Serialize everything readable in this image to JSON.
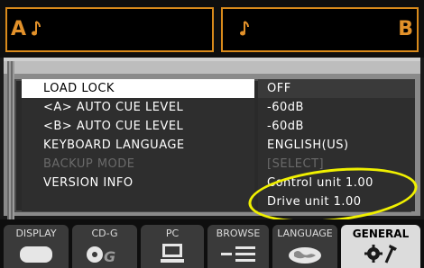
{
  "decks": {
    "a": {
      "letter": "A"
    },
    "b": {
      "letter": "B"
    }
  },
  "menu": {
    "rows": [
      {
        "label": "LOAD LOCK",
        "value": "OFF"
      },
      {
        "label": "<A> AUTO CUE LEVEL",
        "value": "-60dB"
      },
      {
        "label": "<B> AUTO CUE LEVEL",
        "value": "-60dB"
      },
      {
        "label": "KEYBOARD LANGUAGE",
        "value": "ENGLISH(US)"
      },
      {
        "label": "BACKUP MODE",
        "value": "[SELECT]"
      },
      {
        "label": "VERSION INFO",
        "value": "Control unit 1.00"
      },
      {
        "label": "",
        "value": "Drive unit 1.00"
      }
    ],
    "selected_index": 0,
    "disabled_index": 4
  },
  "tabs": [
    {
      "label": "DISPLAY",
      "icon": "display-icon"
    },
    {
      "label": "CD-G",
      "icon": "cd-g-icon"
    },
    {
      "label": "PC",
      "icon": "pc-icon"
    },
    {
      "label": "BROWSE",
      "icon": "browse-icon"
    },
    {
      "label": "LANGUAGE",
      "icon": "globe-icon"
    },
    {
      "label": "GENERAL",
      "icon": "tools-icon"
    }
  ],
  "colors": {
    "deck_accent": "#d98a1b",
    "highlight_ellipse": "#f0f000"
  }
}
